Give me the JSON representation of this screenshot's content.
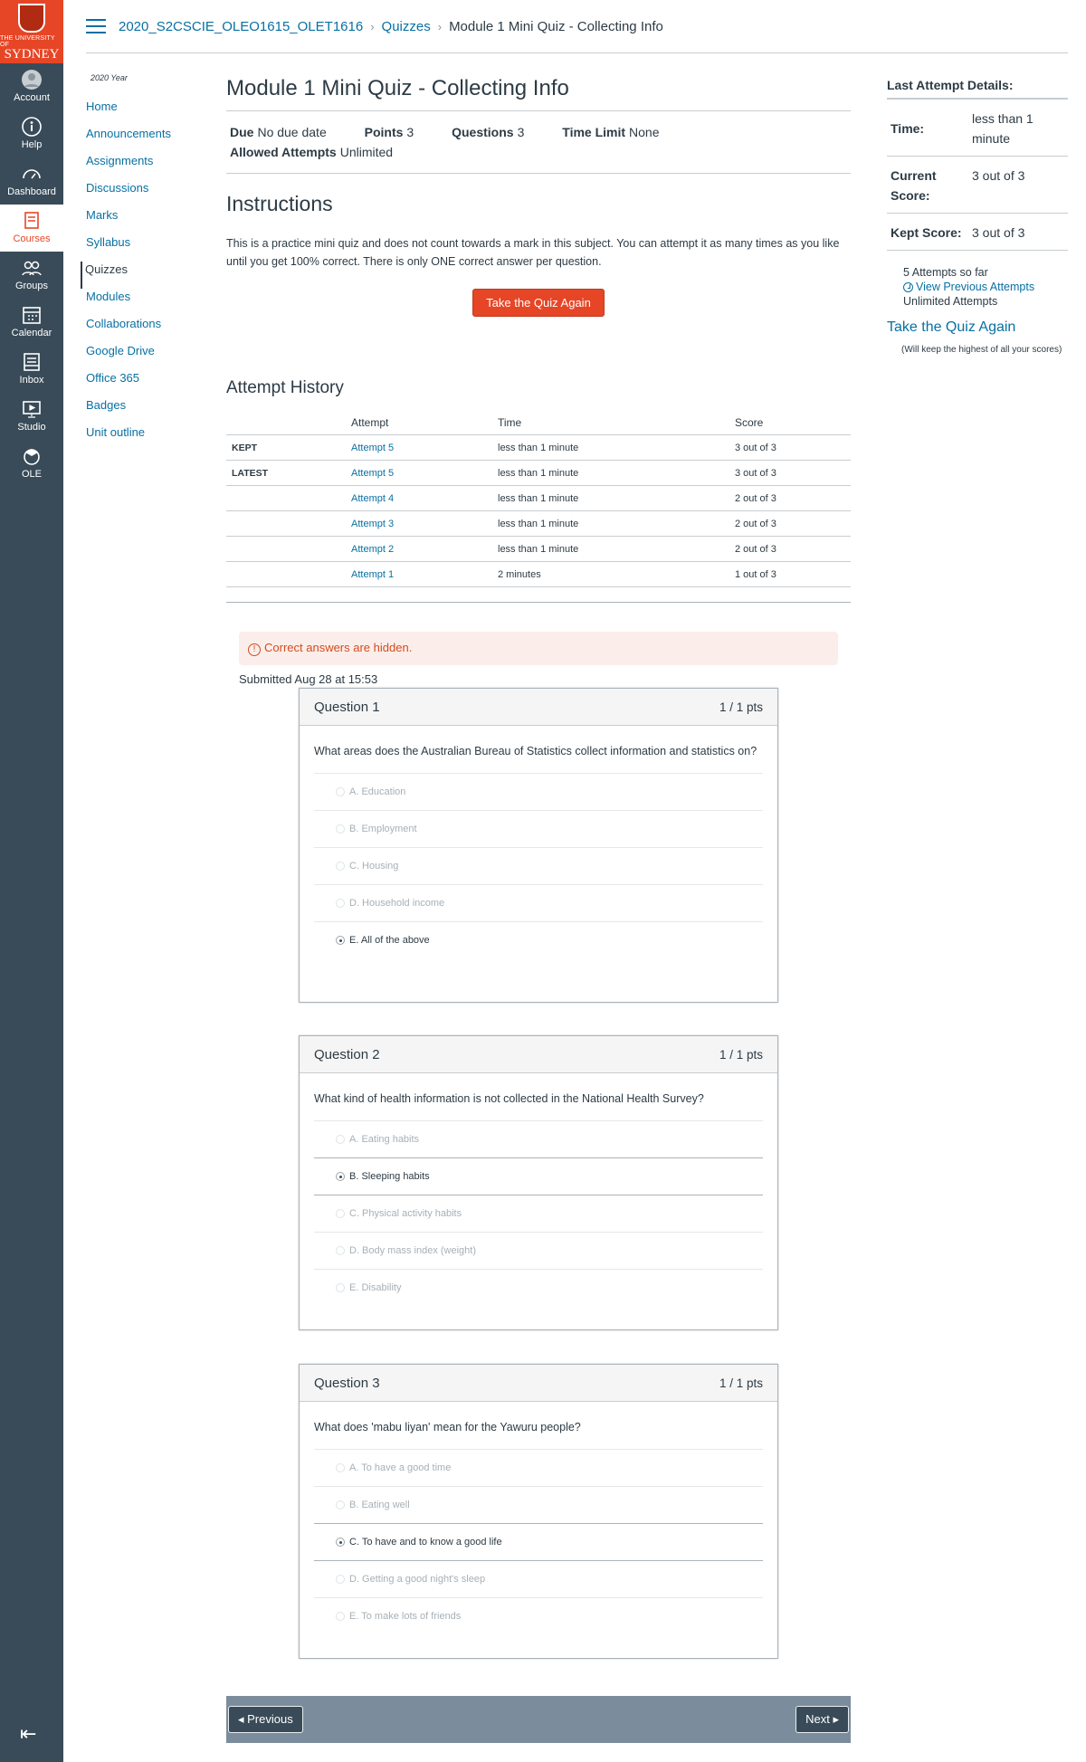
{
  "gnav": {
    "logo": {
      "university": "THE UNIVERSITY OF",
      "name": "SYDNEY"
    },
    "items": [
      {
        "label": "Account",
        "icon": "account-icon"
      },
      {
        "label": "Help",
        "icon": "help-icon"
      },
      {
        "label": "Dashboard",
        "icon": "dashboard-icon"
      },
      {
        "label": "Courses",
        "icon": "courses-icon",
        "active": true
      },
      {
        "label": "Groups",
        "icon": "groups-icon"
      },
      {
        "label": "Calendar",
        "icon": "calendar-icon"
      },
      {
        "label": "Inbox",
        "icon": "inbox-icon"
      },
      {
        "label": "Studio",
        "icon": "studio-icon"
      },
      {
        "label": "OLE",
        "icon": "ole-icon"
      }
    ],
    "collapse_icon": "collapse-nav-icon"
  },
  "breadcrumb": {
    "course": "2020_S2CSCIE_OLEO1615_OLET1616",
    "section": "Quizzes",
    "current": "Module 1 Mini Quiz - Collecting Info"
  },
  "course_nav": {
    "year": "2020 Year",
    "items": [
      "Home",
      "Announcements",
      "Assignments",
      "Discussions",
      "Marks",
      "Syllabus",
      "Quizzes",
      "Modules",
      "Collaborations",
      "Google Drive",
      "Office 365",
      "Badges",
      "Unit outline"
    ],
    "active": "Quizzes"
  },
  "quiz": {
    "title": "Module 1 Mini Quiz - Collecting Info",
    "meta": {
      "due_label": "Due",
      "due": "No due date",
      "points_label": "Points",
      "points": "3",
      "questions_label": "Questions",
      "questions": "3",
      "time_limit_label": "Time Limit",
      "time_limit": "None",
      "attempts_label": "Allowed Attempts",
      "attempts": "Unlimited"
    },
    "instructions_heading": "Instructions",
    "instructions": "This is a practice mini quiz and does not count towards a mark in this subject. You can attempt it as many times as you like until you get 100% correct. There is only ONE correct answer per question.",
    "take_again": "Take the Quiz Again"
  },
  "history": {
    "heading": "Attempt History",
    "columns": [
      "",
      "Attempt",
      "Time",
      "Score"
    ],
    "rows": [
      {
        "tag": "KEPT",
        "attempt": "Attempt 5",
        "time": "less than 1 minute",
        "score": "3 out of 3"
      },
      {
        "tag": "LATEST",
        "attempt": "Attempt 5",
        "time": "less than 1 minute",
        "score": "3 out of 3"
      },
      {
        "tag": "",
        "attempt": "Attempt 4",
        "time": "less than 1 minute",
        "score": "2 out of 3"
      },
      {
        "tag": "",
        "attempt": "Attempt 3",
        "time": "less than 1 minute",
        "score": "2 out of 3"
      },
      {
        "tag": "",
        "attempt": "Attempt 2",
        "time": "less than 1 minute",
        "score": "2 out of 3"
      },
      {
        "tag": "",
        "attempt": "Attempt 1",
        "time": "2 minutes",
        "score": "1 out of 3"
      }
    ]
  },
  "alert": {
    "text": "Correct answers are hidden.",
    "icon": "warning-icon"
  },
  "submitted": "Submitted Aug 28 at 15:53",
  "questions": [
    {
      "title": "Question 1",
      "points": "1 / 1 pts",
      "text": "What areas does the Australian Bureau of Statistics collect information and statistics on?",
      "answers": [
        "A. Education",
        "B. Employment",
        "C. Housing",
        "D. Household income",
        "E. All of the above"
      ],
      "selected": 4
    },
    {
      "title": "Question 2",
      "points": "1 / 1 pts",
      "text": "What kind of health information is not collected in the National Health Survey?",
      "answers": [
        "A. Eating habits",
        "B. Sleeping habits",
        "C. Physical activity habits",
        "D. Body mass index (weight)",
        "E. Disability"
      ],
      "selected": 1
    },
    {
      "title": "Question 3",
      "points": "1 / 1 pts",
      "text": "What does 'mabu liyan' mean for the Yawuru people?",
      "answers": [
        "A. To have a good time",
        "B. Eating well",
        "C. To have and to know a good life",
        "D. Getting a good night's sleep",
        "E. To make lots of friends"
      ],
      "selected": 2
    }
  ],
  "pager": {
    "previous": "◂ Previous",
    "next": "Next ▸"
  },
  "sidebar": {
    "title": "Last Attempt Details:",
    "time_label": "Time:",
    "time": "less than 1 minute",
    "current_label": "Current Score:",
    "current": "3 out of 3",
    "kept_label": "Kept Score:",
    "kept": "3 out of 3",
    "attempts_so_far": "5 Attempts so far",
    "view_previous": "View Previous Attempts",
    "unlimited": "Unlimited Attempts",
    "take_again": "Take the Quiz Again",
    "note": "(Will keep the highest of all your scores)"
  }
}
